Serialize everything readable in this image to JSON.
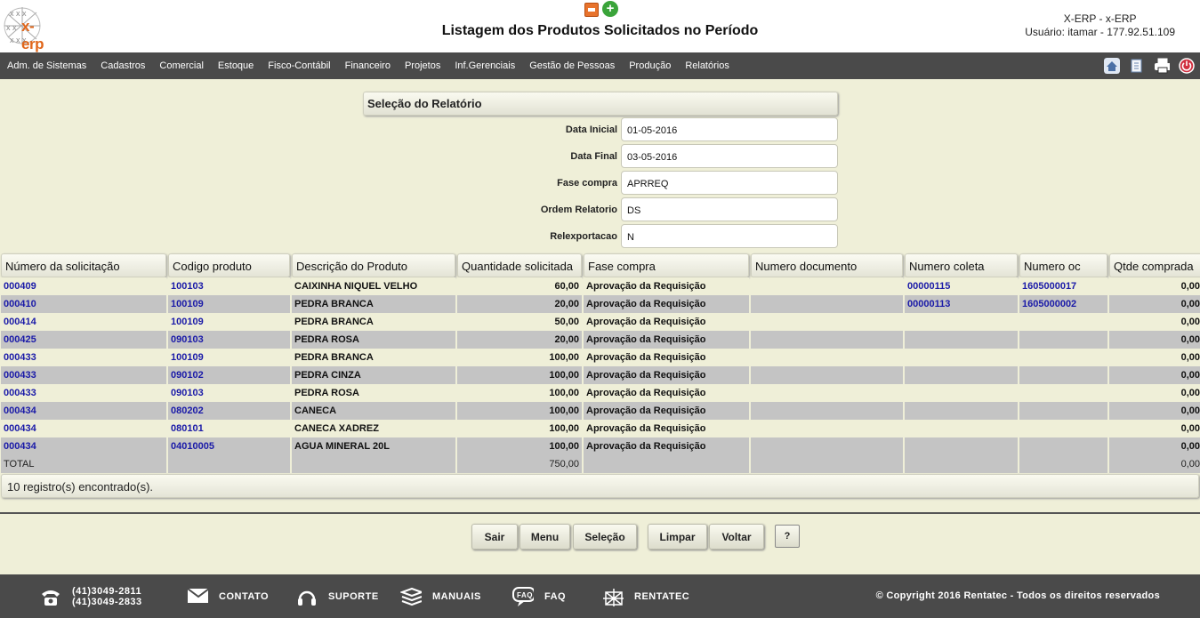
{
  "header": {
    "logo_text": "x-erp",
    "title": "Listagem dos Produtos Solicitados no Período",
    "system": "X-ERP - x-ERP",
    "user": "Usuário: itamar - 177.92.51.109"
  },
  "menu": {
    "items": [
      "Adm. de Sistemas",
      "Cadastros",
      "Comercial",
      "Estoque",
      "Fisco-Contábil",
      "Financeiro",
      "Projetos",
      "Inf.Gerenciais",
      "Gestão de Pessoas",
      "Produção",
      "Relatórios"
    ]
  },
  "selection": {
    "title": "Seleção do Relatório",
    "fields": [
      {
        "label": "Data Inicial",
        "value": "01-05-2016"
      },
      {
        "label": "Data Final",
        "value": "03-05-2016"
      },
      {
        "label": "Fase compra",
        "value": "APRREQ"
      },
      {
        "label": "Ordem Relatorio",
        "value": "DS"
      },
      {
        "label": "Relexportacao",
        "value": "N"
      }
    ]
  },
  "table": {
    "columns": [
      "Número da solicitação",
      "Codigo produto",
      "Descrição do Produto",
      "Quantidade solicitada",
      "Fase compra",
      "Numero documento",
      "Numero coleta",
      "Numero oc",
      "Qtde comprada"
    ],
    "rows": [
      [
        "000409",
        "100103",
        "CAIXINHA NIQUEL VELHO",
        "60,00",
        "Aprovação da Requisição",
        "",
        "00000115",
        "1605000017",
        "0,00"
      ],
      [
        "000410",
        "100109",
        "PEDRA BRANCA",
        "20,00",
        "Aprovação da Requisição",
        "",
        "00000113",
        "1605000002",
        "0,00"
      ],
      [
        "000414",
        "100109",
        "PEDRA BRANCA",
        "50,00",
        "Aprovação da Requisição",
        "",
        "",
        "",
        "0,00"
      ],
      [
        "000425",
        "090103",
        "PEDRA ROSA",
        "20,00",
        "Aprovação da Requisição",
        "",
        "",
        "",
        "0,00"
      ],
      [
        "000433",
        "100109",
        "PEDRA BRANCA",
        "100,00",
        "Aprovação da Requisição",
        "",
        "",
        "",
        "0,00"
      ],
      [
        "000433",
        "090102",
        "PEDRA CINZA",
        "100,00",
        "Aprovação da Requisição",
        "",
        "",
        "",
        "0,00"
      ],
      [
        "000433",
        "090103",
        "PEDRA ROSA",
        "100,00",
        "Aprovação da Requisição",
        "",
        "",
        "",
        "0,00"
      ],
      [
        "000434",
        "080202",
        "CANECA",
        "100,00",
        "Aprovação da Requisição",
        "",
        "",
        "",
        "0,00"
      ],
      [
        "000434",
        "080101",
        "CANECA XADREZ",
        "100,00",
        "Aprovação da Requisição",
        "",
        "",
        "",
        "0,00"
      ],
      [
        "000434",
        "04010005",
        "AGUA MINERAL 20L",
        "100,00",
        "Aprovação da Requisição",
        "",
        "",
        "",
        "0,00"
      ]
    ],
    "total": [
      "TOTAL",
      "",
      "",
      "750,00",
      "",
      "",
      "",
      "",
      "0,00"
    ],
    "records_found": "10 registro(s) encontrado(s)."
  },
  "buttons": {
    "sair": "Sair",
    "menu": "Menu",
    "selecao": "Seleção",
    "limpar": "Limpar",
    "voltar": "Voltar",
    "help": "?"
  },
  "footer": {
    "phone1": "(41)3049-2811",
    "phone2": "(41)3049-2833",
    "contato": "CONTATO",
    "suporte": "SUPORTE",
    "manuais": "MANUAIS",
    "faq": "FAQ",
    "rentatec": "RENTATEC",
    "copyright": "© Copyright 2016 Rentatec - Todos os direitos reservados"
  },
  "colors": {
    "background": "#efefd8",
    "bar": "#4a4a4a",
    "link": "#1a1aa8",
    "row_alt": "#c4c4c4"
  }
}
